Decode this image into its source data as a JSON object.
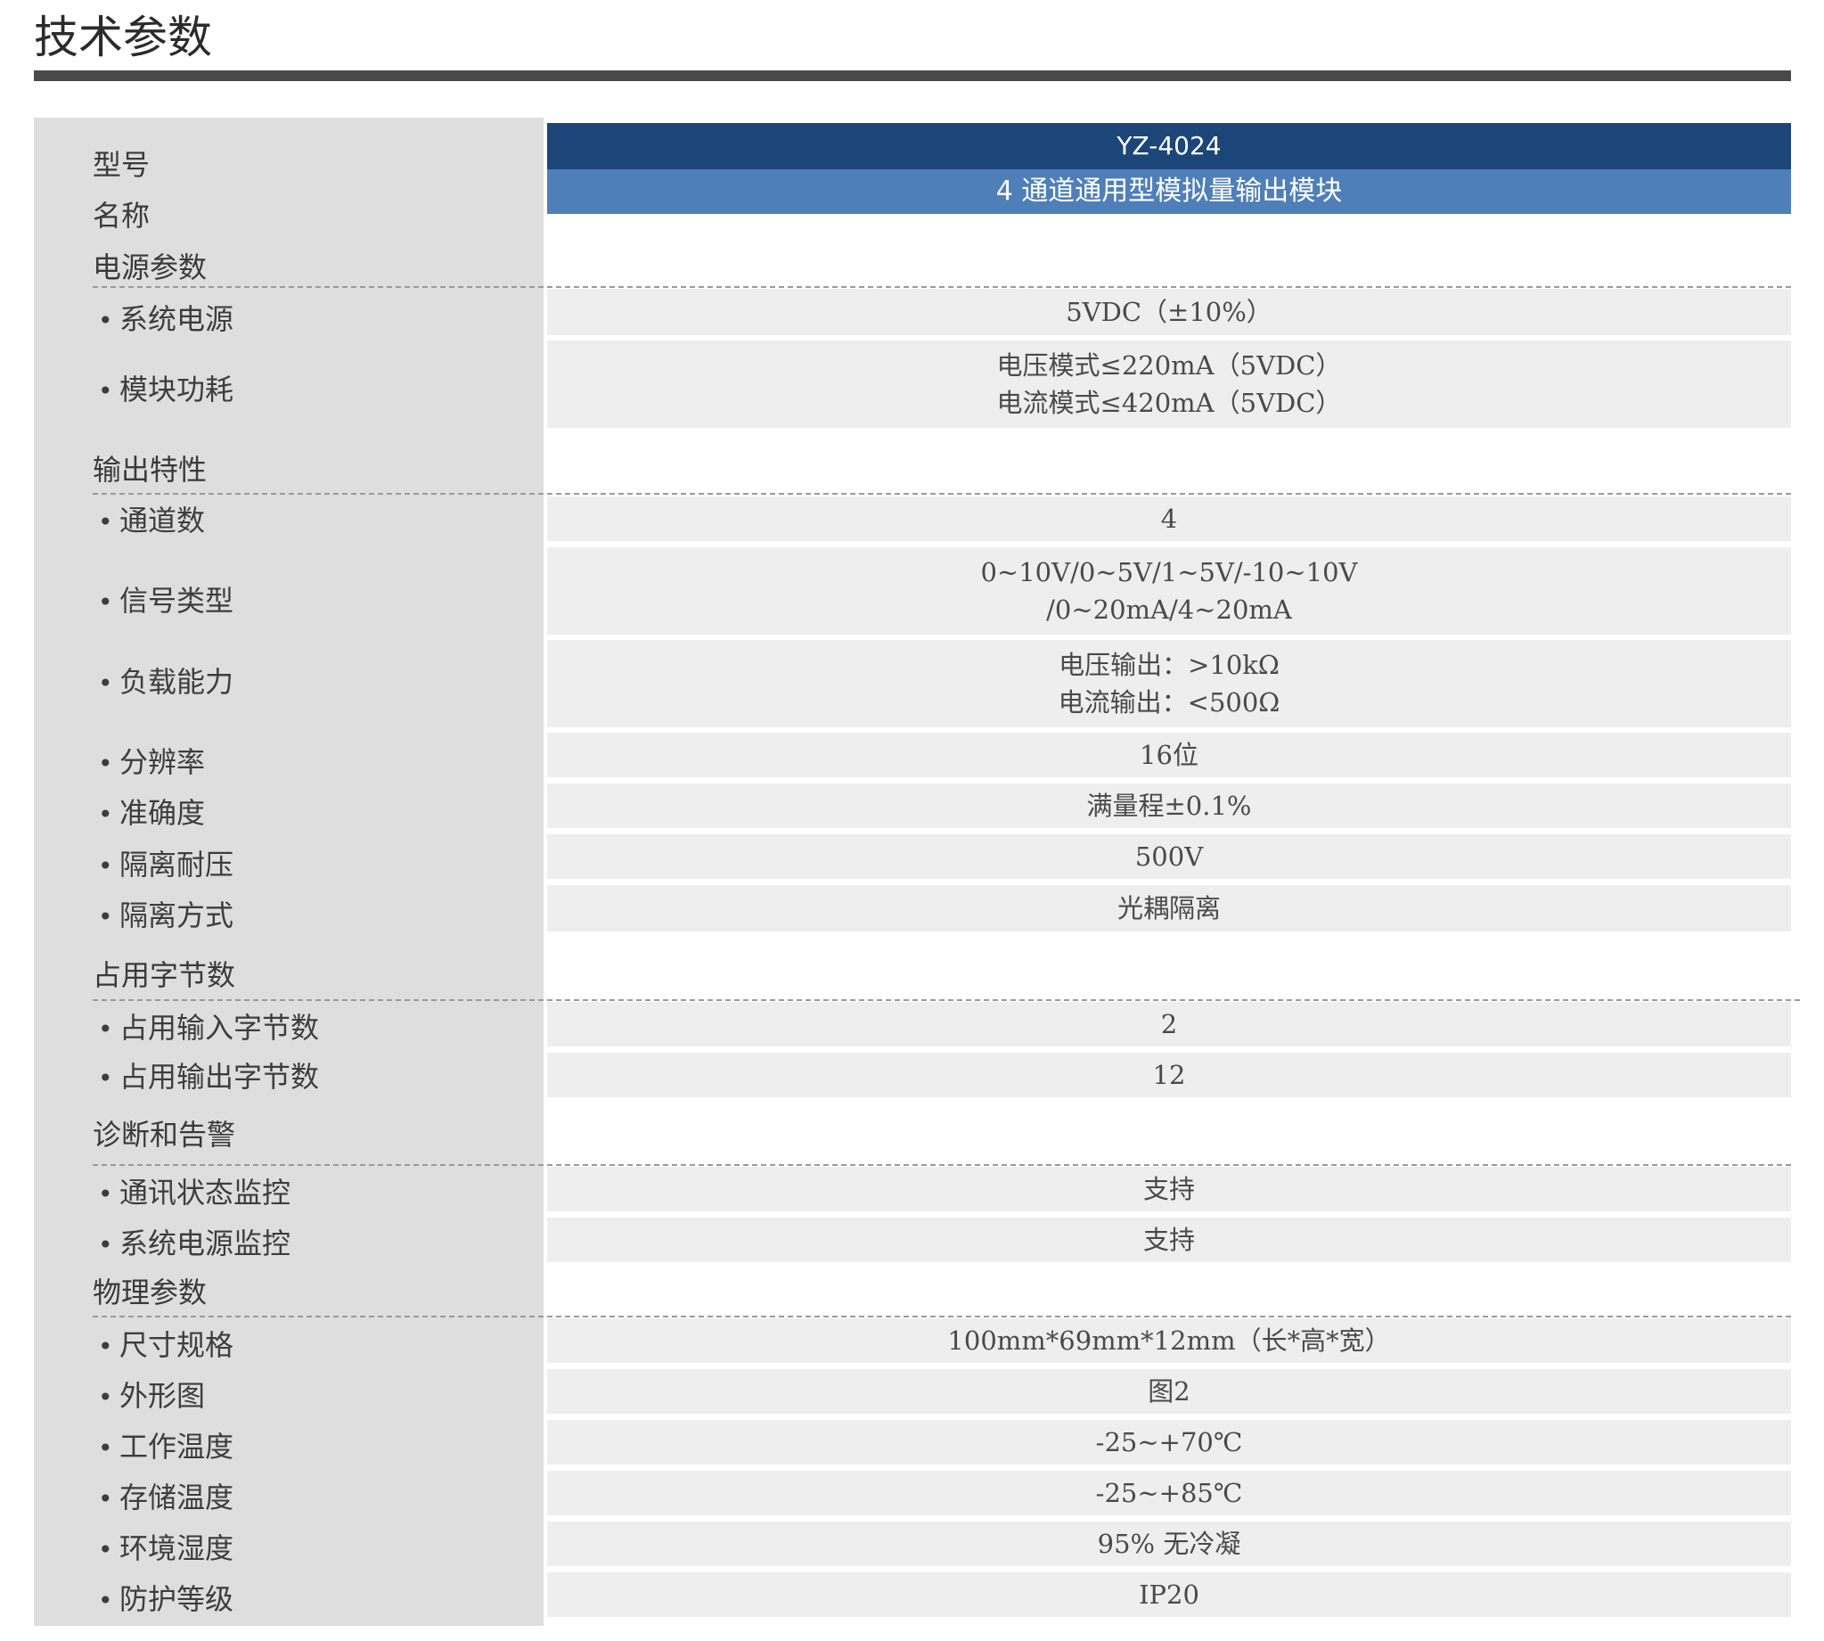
{
  "page_title": "技术参数",
  "header": {
    "model_label": "型号",
    "model_value": "YZ-4024",
    "name_label": "名称",
    "name_value": "4 通道通用型模拟量输出模块"
  },
  "sections": {
    "power": {
      "title": "电源参数",
      "rows": [
        {
          "label": "系统电源",
          "value": [
            "5VDC（±10%）"
          ]
        },
        {
          "label": "模块功耗",
          "value": [
            "电压模式≤220mA（5VDC）",
            "电流模式≤420mA（5VDC）"
          ]
        }
      ]
    },
    "output": {
      "title": "输出特性",
      "rows": [
        {
          "label": "通道数",
          "value": [
            "4"
          ]
        },
        {
          "label": "信号类型",
          "value": [
            "0~10V/0~5V/1~5V/-10~10V",
            "/0~20mA/4~20mA"
          ]
        },
        {
          "label": "负载能力",
          "value": [
            "电压输出：>10kΩ",
            "电流输出：<500Ω"
          ]
        },
        {
          "label": "分辨率",
          "value": [
            "16位"
          ]
        },
        {
          "label": "准确度",
          "value": [
            "满量程±0.1%"
          ]
        },
        {
          "label": "隔离耐压",
          "value": [
            "500V"
          ]
        },
        {
          "label": "隔离方式",
          "value": [
            "光耦隔离"
          ]
        }
      ]
    },
    "bytes": {
      "title": "占用字节数",
      "rows": [
        {
          "label": "占用输入字节数",
          "value": [
            "2"
          ]
        },
        {
          "label": "占用输出字节数",
          "value": [
            "12"
          ]
        }
      ]
    },
    "diag": {
      "title": "诊断和告警",
      "rows": [
        {
          "label": "通讯状态监控",
          "value": [
            "支持"
          ]
        },
        {
          "label": "系统电源监控",
          "value": [
            "支持"
          ]
        }
      ]
    },
    "physical": {
      "title": "物理参数",
      "rows": [
        {
          "label": "尺寸规格",
          "value": [
            "100mm*69mm*12mm（长*高*宽）"
          ]
        },
        {
          "label": "外形图",
          "value": [
            "图2"
          ]
        },
        {
          "label": "工作温度",
          "value": [
            "-25~+70℃"
          ]
        },
        {
          "label": "存储温度",
          "value": [
            "-25~+85℃"
          ]
        },
        {
          "label": "环境湿度",
          "value": [
            "95% 无冷凝"
          ]
        },
        {
          "label": "防护等级",
          "value": [
            "IP20"
          ]
        }
      ]
    }
  },
  "colors": {
    "model_bar": "#1c4677",
    "name_bar": "#4f7fb9",
    "label_panel": "#dedede",
    "value_row": "#eeeeee",
    "title_rule": "#4a4a4a"
  }
}
